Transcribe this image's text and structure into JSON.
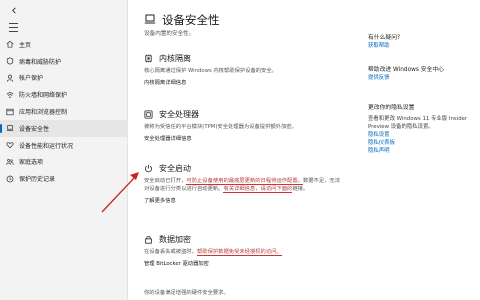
{
  "sidebar": {
    "back_icon": "back-arrow-icon",
    "menu_icon": "hamburger-menu-icon",
    "items": [
      {
        "label": "主页",
        "icon": "home-icon"
      },
      {
        "label": "病毒和威胁防护",
        "icon": "shield-icon"
      },
      {
        "label": "帐户保护",
        "icon": "person-icon"
      },
      {
        "label": "防火墙和网络保护",
        "icon": "wifi-icon"
      },
      {
        "label": "应用和浏览器控制",
        "icon": "app-window-icon"
      },
      {
        "label": "设备安全性",
        "icon": "device-laptop-icon",
        "active": true
      },
      {
        "label": "设备性能和运行状况",
        "icon": "heart-icon"
      },
      {
        "label": "家庭选项",
        "icon": "family-icon"
      },
      {
        "label": "保护历史记录",
        "icon": "history-icon"
      }
    ]
  },
  "main": {
    "title": "设备安全性",
    "subtitle": "设备内置的安全性。",
    "sections": {
      "core_isolation": {
        "title": "内核隔离",
        "desc": "核心隔离通过保护 Windows 内核帮助保护设备的安全。",
        "link": "内核隔离详细信息"
      },
      "security_processor": {
        "title": "安全处理器",
        "desc": "被称为受信任的平台模块(TPM)安全处理器为设备提供额外加密。",
        "link": "安全处理器详细信息"
      },
      "secure_boot": {
        "title": "安全启动",
        "desc_1": "安全启动已打开，",
        "desc_hl_1": "可防止设备使用的最底层更新的日程待运作配置。",
        "desc_2": "数据不足，无法对设备进行分类以进行自动更新。",
        "desc_hl_2": "有关详细信息，请访问下面的",
        "desc_3": "链接。",
        "link": "了解更多信息"
      },
      "data_encryption": {
        "title": "数据加密",
        "desc_1": "在设备丢失或被盗时，",
        "desc_hl_1": "帮助保护数据免受未经授权的访问。",
        "link": "管理 BitLocker 驱动器加密"
      }
    },
    "footer": "你的设备满足增强的硬件安全要求。"
  },
  "right": {
    "help": {
      "title": "有什么疑问?",
      "link": "获取帮助"
    },
    "improve": {
      "title": "帮助改进 Windows 安全中心",
      "link": "提供反馈"
    },
    "privacy": {
      "title": "更改你的隐私设置",
      "desc": "查看和更改 Windows 11 专业版 Insider Preview 设备的隐私设置。",
      "links": [
        "隐私设置",
        "隐私仪表板",
        "隐私声明"
      ]
    }
  }
}
